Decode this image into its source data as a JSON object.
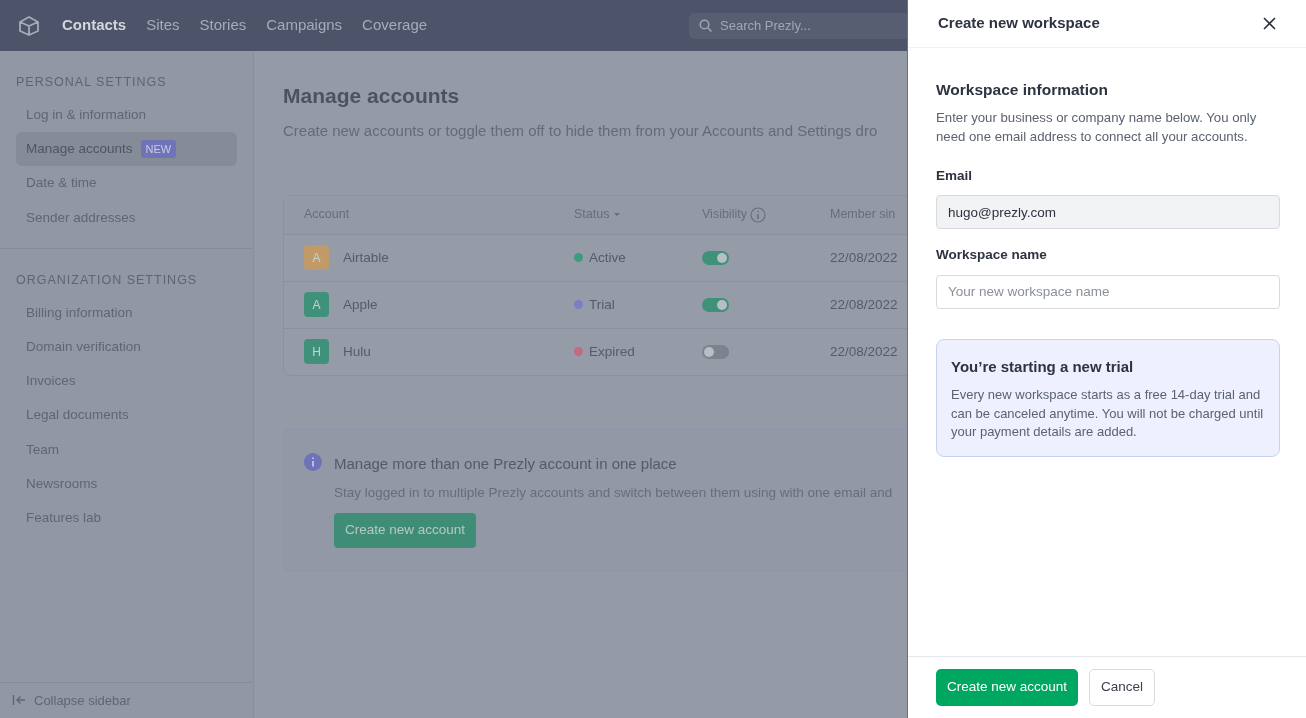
{
  "topbar": {
    "nav": [
      {
        "label": "Contacts",
        "selected": true
      },
      {
        "label": "Sites",
        "selected": false
      },
      {
        "label": "Stories",
        "selected": false
      },
      {
        "label": "Campaigns",
        "selected": false
      },
      {
        "label": "Coverage",
        "selected": false
      }
    ],
    "search": {
      "placeholder": "Search Prezly..."
    }
  },
  "sidebar": {
    "sections": [
      {
        "heading": "PERSONAL SETTINGS",
        "items": [
          {
            "label": "Log in & information",
            "selected": false
          },
          {
            "label": "Manage accounts",
            "badge": "NEW",
            "selected": true
          },
          {
            "label": "Date & time",
            "selected": false
          },
          {
            "label": "Sender addresses",
            "selected": false
          }
        ]
      },
      {
        "heading": "ORGANIZATION SETTINGS",
        "items": [
          {
            "label": "Billing information",
            "selected": false
          },
          {
            "label": "Domain verification",
            "selected": false
          },
          {
            "label": "Invoices",
            "selected": false
          },
          {
            "label": "Legal documents",
            "selected": false
          },
          {
            "label": "Team",
            "selected": false
          },
          {
            "label": "Newsrooms",
            "selected": false
          },
          {
            "label": "Features lab",
            "selected": false
          }
        ]
      }
    ],
    "collapse": "Collapse sidebar"
  },
  "main": {
    "title": "Manage accounts",
    "subtitle": "Create new accounts or toggle them off to hide them from your Accounts and Settings dro",
    "table": {
      "columns": [
        "Account",
        "Status",
        "Visibility",
        "Member sin"
      ],
      "rows": [
        {
          "avatar": {
            "initial": "A",
            "color": "#c19a69"
          },
          "name": "Airtable",
          "status": {
            "label": "Active",
            "color": "#3f9c7b"
          },
          "visible": true,
          "date": "22/08/2022"
        },
        {
          "avatar": {
            "initial": "A",
            "color": "#3f917a"
          },
          "name": "Apple",
          "status": {
            "label": "Trial",
            "color": "#7b80c6"
          },
          "visible": true,
          "date": "22/08/2022"
        },
        {
          "avatar": {
            "initial": "H",
            "color": "#3f917a"
          },
          "name": "Hulu",
          "status": {
            "label": "Expired",
            "color": "#c06b82"
          },
          "visible": false,
          "date": "22/08/2022"
        }
      ]
    },
    "callout": {
      "title": "Manage more than one Prezly account in one place",
      "text": "Stay logged in to multiple Prezly accounts and switch between them using with one email and",
      "button": "Create new account"
    }
  },
  "panel": {
    "title": "Create new workspace",
    "section_title": "Workspace information",
    "description": "Enter your business or company name below. You only need one email address to connect all your accounts.",
    "fields": [
      {
        "label": "Email",
        "value": "hugo@prezly.com",
        "disabled": true
      },
      {
        "label": "Workspace name",
        "placeholder": "Your new workspace name",
        "disabled": false
      }
    ],
    "notice": {
      "title": "You’re starting a new trial",
      "text": "Every new workspace starts as a free 14-day trial and can be canceled anytime. You will not be charged until your payment details are added."
    },
    "buttons": [
      {
        "label": "Create new account",
        "kind": "primary"
      },
      {
        "label": "Cancel",
        "kind": "secondary"
      }
    ]
  }
}
